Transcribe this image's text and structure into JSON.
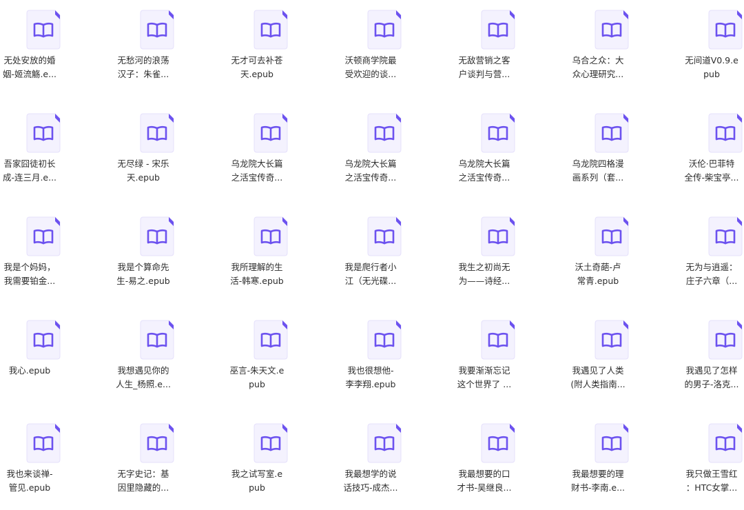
{
  "colors": {
    "page_bg": "#ffffff",
    "icon_bg": "#f4f2fe",
    "icon_border": "#e5e0fb",
    "icon_fold": "#6c52ef",
    "book_glyph": "#6c52ef",
    "label_text": "#2d2d2d"
  },
  "icon": "epub-book-file-icon",
  "files": [
    [
      "无处安放的婚",
      "姻-姬流觞.e..."
    ],
    [
      "无愁河的浪荡",
      "汉子：朱雀..."
    ],
    [
      "无才可去补苍",
      "天.epub"
    ],
    [
      "沃顿商学院最",
      "受欢迎的谈..."
    ],
    [
      "无敌营销之客",
      "户谈判与营..."
    ],
    [
      "乌合之众：大",
      "众心理研究..."
    ],
    [
      "无间道V0.9.e",
      "pub"
    ],
    [
      "吾家囧徒初长",
      "成-连三月.e..."
    ],
    [
      "无尽绿 - 宋乐",
      "天.epub"
    ],
    [
      "乌龙院大长篇",
      "之活宝传奇..."
    ],
    [
      "乌龙院大长篇",
      "之活宝传奇..."
    ],
    [
      "乌龙院大长篇",
      "之活宝传奇..."
    ],
    [
      "乌龙院四格漫",
      "画系列（套..."
    ],
    [
      "沃伦·巴菲特",
      "全传-柴宝亭..."
    ],
    [
      "我是个妈妈，",
      "我需要铂金..."
    ],
    [
      "我是个算命先",
      "生-易之.epub"
    ],
    [
      "我所理解的生",
      "活-韩寒.epub"
    ],
    [
      "我是爬行者小",
      "江（无光碟..."
    ],
    [
      "我生之初尚无",
      "为——诗经..."
    ],
    [
      "沃土奇葩-卢",
      "常青.epub"
    ],
    [
      "无为与逍遥：",
      "庄子六章（..."
    ],
    [
      "我心.epub"
    ],
    [
      "我想遇见你的",
      "人生_杨照.e..."
    ],
    [
      "巫言-朱天文.e",
      "pub"
    ],
    [
      "我也很想他-",
      "李李翔.epub"
    ],
    [
      "我要渐渐忘记",
      "这个世界了 ..."
    ],
    [
      "我遇见了人类",
      "(附人类指南..."
    ],
    [
      "我遇见了怎样",
      "的男子-洛克..."
    ],
    [
      "我也来谈禅-",
      "管见.epub"
    ],
    [
      "无字史记：基",
      "因里隐藏的..."
    ],
    [
      "我之试写室.e",
      "pub"
    ],
    [
      "我最想学的说",
      "话技巧-成杰..."
    ],
    [
      "我最想要的口",
      "才书-吴继良..."
    ],
    [
      "我最想要的理",
      "财书-李南.e..."
    ],
    [
      "我只做王雪红",
      "：HTC女掌..."
    ]
  ]
}
